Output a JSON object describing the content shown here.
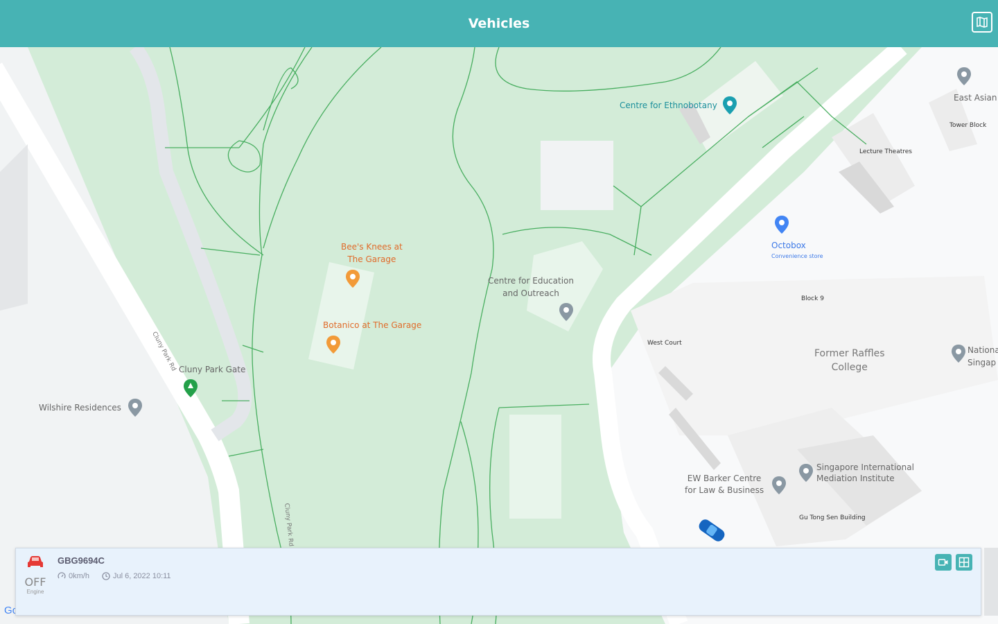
{
  "header": {
    "title": "Vehicles"
  },
  "map": {
    "labels": {
      "ethnobotany": "Centre for Ethnobotany",
      "east_asian": "East Asian",
      "tower_block": "Tower Block",
      "lecture_theatres": "Lecture Theatres",
      "octobox": "Octobox",
      "octobox_sub": "Convenience store",
      "bees_knees": "Bee's Knees at\nThe Garage",
      "centre_education": "Centre for Education\nand Outreach",
      "block9": "Block 9",
      "botanico": "Botanico at The Garage",
      "west_court": "West Court",
      "former_raffles": "Former Raffles\nCollege",
      "national": "National\nSingap",
      "cluny_park_gate": "Cluny Park Gate",
      "wilshire": "Wilshire Residences",
      "cluny_park_rd": "Cluny Park Rd",
      "cluny_park_rd2": "Cluny Park Rd",
      "sg_mediation": "Singapore International\nMediation Institute",
      "ew_barker": "EW Barker Centre\nfor Law & Business",
      "gu_tong": "Gu Tong Sen Building"
    },
    "attribution": "Google"
  },
  "vehicle": {
    "plate": "GBG9694C",
    "engine_state": "OFF",
    "engine_label": "Engine",
    "speed": "0km/h",
    "timestamp": "Jul 6, 2022 10:11",
    "status_color": "#e53935"
  },
  "colors": {
    "accent": "#47b3b4",
    "park": "#d3ecd8",
    "path": "#2fa34a"
  }
}
